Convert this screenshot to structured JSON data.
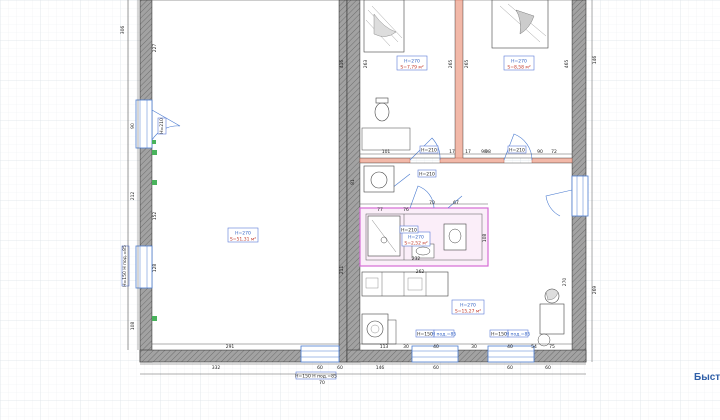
{
  "colors": {
    "grid": "#eaeef1",
    "grid_major": "#dde3e8",
    "wall": "#8f8f8f",
    "wall_stroke": "#333333",
    "tag_border": "#5a7bd8",
    "area_text": "#c0392b",
    "magenta": "#d46cd4",
    "orange_wall": "#f2b8a8",
    "green_mark": "#49b35c"
  },
  "icons": {
    "door": "door-swing-icon",
    "window": "window-icon",
    "bathtub": "bathtub-icon",
    "toilet": "toilet-icon",
    "sink": "sink-icon",
    "washer": "washing-machine-icon",
    "bed": "bed-icon",
    "plant": "plant-icon"
  },
  "rooms": {
    "big_room": {
      "height": "H=270",
      "area": "S=51,31 м²"
    },
    "bedroom_left": {
      "height": "H=270",
      "area": "S=7,79 м²"
    },
    "bedroom_right": {
      "height": "H=270",
      "area": "S=8,58 м²"
    },
    "bath": {
      "height": "H=270",
      "area": "S=2,52 м²"
    },
    "hall": {
      "height": "H=270",
      "area": "S=15,27 м²"
    }
  },
  "openings": {
    "door_br_left": "H=210",
    "door_bath": "H=210",
    "door_bath2": "H=210",
    "door_br_right": "H=210",
    "window_left": "H=150 H под.=85",
    "window_bottom_left": "H=150 H под.=85",
    "window_hall_1": "H=150",
    "window_hall_2": "H=150",
    "window_hall_sub_1": "H под.=85",
    "window_hall_sub_2": "H под.=85",
    "door_left_top": "H=210"
  },
  "dimensions": {
    "left": [
      "306",
      "227",
      "90",
      "212",
      "152",
      "128",
      "108"
    ],
    "big_bottom": "291",
    "bottom_total": "332",
    "bottom_segments": [
      "60",
      "70",
      "60",
      "146",
      "60",
      "60",
      "60"
    ],
    "hall_bottom": [
      "113",
      "30",
      "40",
      "30",
      "40",
      "54",
      "75"
    ],
    "br_left_bottom": [
      "101",
      "17"
    ],
    "br_left_side": [
      "263",
      "265",
      "416"
    ],
    "br_right_bottom": [
      "17",
      "98",
      "90",
      "72"
    ],
    "br_right_side": [
      "265",
      "465"
    ],
    "corridor": [
      "81",
      "70",
      "67",
      "76",
      "77",
      "108",
      "232",
      "211",
      "262",
      "270",
      "98"
    ],
    "right_side": [
      "269",
      "146"
    ]
  },
  "sidebar_caption": "Быстр"
}
